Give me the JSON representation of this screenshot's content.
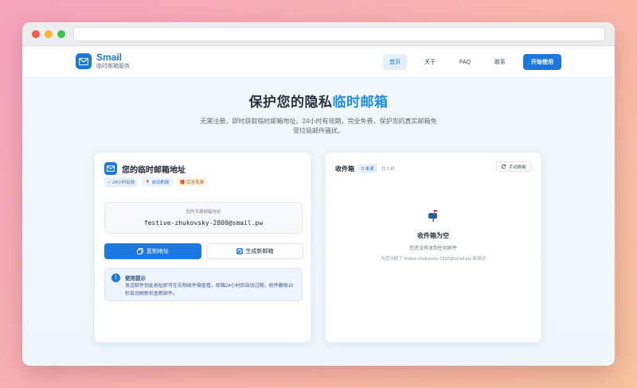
{
  "brand": {
    "name": "Smail",
    "subtitle": "临时邮箱服务"
  },
  "nav": {
    "home": "首页",
    "about": "关于",
    "faq": "FAQ",
    "contact": "联系",
    "cta": "开始使用"
  },
  "hero": {
    "title_part1": "保护您的隐私",
    "title_accent": "临时邮箱",
    "desc_line1": "无需注册，即时获取临时邮箱地址。24小时有效期，完全免费，保护您的真实邮箱免",
    "desc_line2": "受垃圾邮件骚扰。"
  },
  "mailbox": {
    "title": "您的临时邮箱地址",
    "tags": [
      "✓ 24小时有效",
      "自动刷新",
      "完全免费"
    ],
    "address_label": "您的专属邮箱地址",
    "address": "festive-zhukovsky-2800@smail.pw",
    "copy_button": "复制地址",
    "new_button": "生成新邮箱",
    "tip_title": "使用提示",
    "tip_text": "发送邮件到此地址即可在右侧收件箱查看。邮箱24小时后自动过期，收件箱每10秒自动刷新检查新邮件。"
  },
  "inbox": {
    "title": "收件箱",
    "unread_badge": "0 未读",
    "total": "共 0 封",
    "refresh_button": "手动刷新",
    "empty_title": "收件箱为空",
    "empty_sub": "您还没有收到任何邮件",
    "empty_hint": "为您分配了 festive-zhukovsky-2800@smail.pw 来测试"
  },
  "colors": {
    "accent": "#1b78e0",
    "hero_accent": "#1b8de3"
  }
}
